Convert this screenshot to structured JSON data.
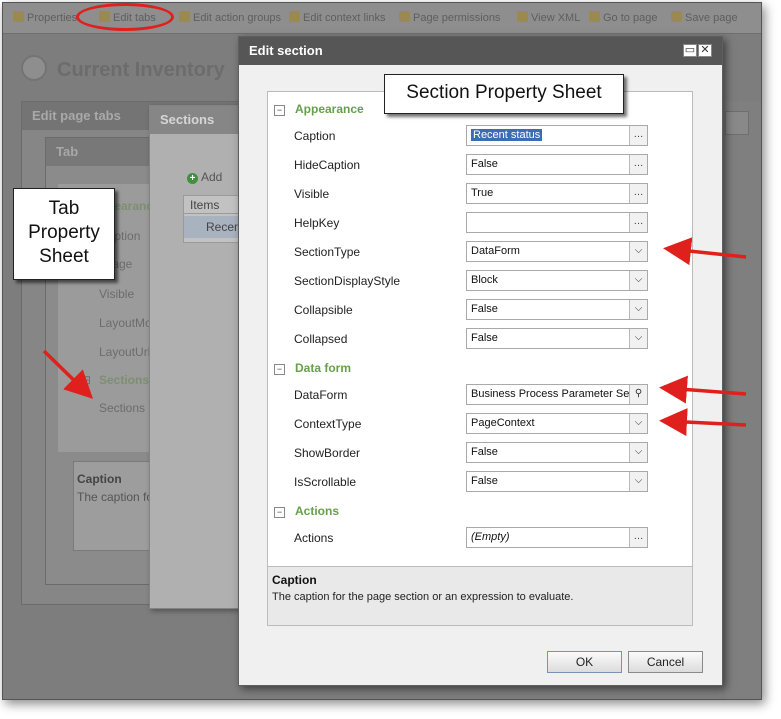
{
  "toolbar": {
    "items": [
      "Properties",
      "Edit tabs",
      "Edit action groups",
      "Edit context links",
      "Page permissions",
      "View XML",
      "Go to page",
      "Save page"
    ]
  },
  "background": {
    "page_title": "Current Inventory",
    "edit_page_tabs_title": "Edit page tabs",
    "tab_dialog_title": "Tab",
    "tab_props": [
      "Appearance",
      "Caption",
      "Image",
      "Visible",
      "LayoutMode",
      "LayoutUrl",
      "Sections",
      "Sections"
    ],
    "tab_desc_title": "Caption",
    "tab_desc_text": "The caption fo",
    "sections_dialog_title": "Sections",
    "add_label": "Add",
    "items_header": "Items",
    "items_row": "Recen"
  },
  "callouts": {
    "tab": [
      "Tab",
      "Property",
      "Sheet"
    ],
    "section": "Section Property Sheet"
  },
  "dialog": {
    "title": "Edit section",
    "groups": {
      "appearance": "Appearance",
      "data_form": "Data form",
      "actions": "Actions"
    },
    "props": {
      "caption": {
        "label": "Caption",
        "value": "Recent status"
      },
      "hide_caption": {
        "label": "HideCaption",
        "value": "False"
      },
      "visible": {
        "label": "Visible",
        "value": "True"
      },
      "help_key": {
        "label": "HelpKey",
        "value": ""
      },
      "section_type": {
        "label": "SectionType",
        "value": "DataForm"
      },
      "section_display_style": {
        "label": "SectionDisplayStyle",
        "value": "Block"
      },
      "collapsible": {
        "label": "Collapsible",
        "value": "False"
      },
      "collapsed": {
        "label": "Collapsed",
        "value": "False"
      },
      "data_form": {
        "label": "DataForm",
        "value": "Business Process Parameter Set Re"
      },
      "context_type": {
        "label": "ContextType",
        "value": "PageContext"
      },
      "show_border": {
        "label": "ShowBorder",
        "value": "False"
      },
      "is_scrollable": {
        "label": "IsScrollable",
        "value": "False"
      },
      "actions": {
        "label": "Actions",
        "value": "(Empty)"
      }
    },
    "help": {
      "title": "Caption",
      "text": "The caption for the page section or an expression to evaluate."
    },
    "buttons": {
      "ok": "OK",
      "cancel": "Cancel"
    }
  },
  "colors": {
    "accent_red": "#e0201c",
    "group_green": "#66a04a",
    "title_bar": "#565656",
    "selection": "#3b6db5"
  },
  "icons": [
    "minimize-icon",
    "close-icon",
    "ellipsis-icon",
    "dropdown-arrow-icon",
    "search-icon",
    "collapse-icon",
    "add-icon",
    "red-arrow-icon"
  ]
}
